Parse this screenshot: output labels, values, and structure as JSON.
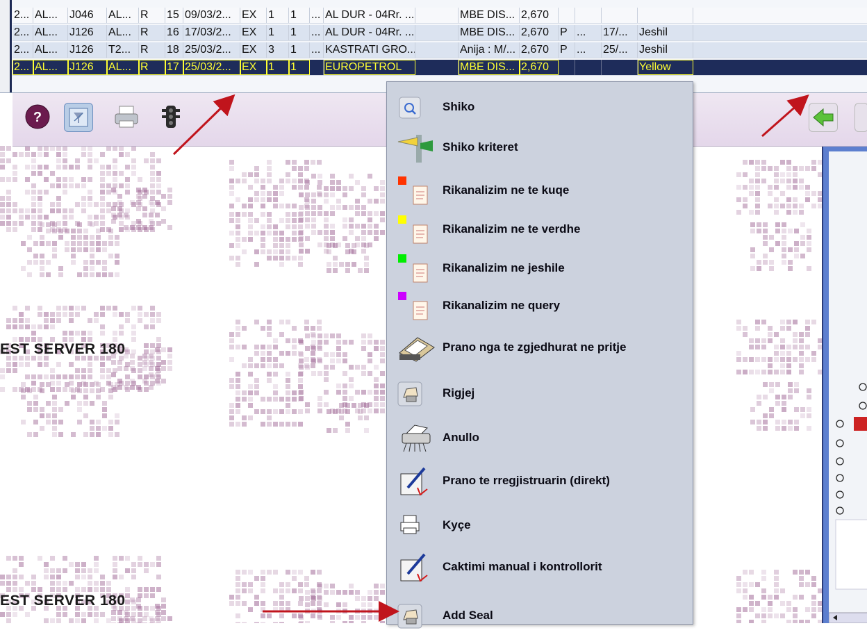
{
  "grid": {
    "rows": [
      {
        "c1": "2...",
        "c2": "AL...",
        "c3": "J046",
        "c4": "AL...",
        "c5": "R",
        "c6": "15",
        "c7": "09/03/2...",
        "c8": "EX",
        "c9": "1",
        "c10": "1",
        "c11": "...",
        "c12": "AL DUR - 04Rr. ...",
        "c13": "",
        "c14": "MBE DIS...",
        "c15": "2,670",
        "c16": "",
        "c17": "",
        "c18": "",
        "c19": ""
      },
      {
        "c1": "2...",
        "c2": "AL...",
        "c3": "J126",
        "c4": "AL...",
        "c5": "R",
        "c6": "16",
        "c7": "17/03/2...",
        "c8": "EX",
        "c9": "1",
        "c10": "1",
        "c11": "...",
        "c12": "AL DUR - 04Rr. ...",
        "c13": "",
        "c14": "MBE DIS...",
        "c15": "2,670",
        "c16": "P",
        "c17": "...",
        "c18": "17/...",
        "c19": "Jeshil"
      },
      {
        "c1": "2...",
        "c2": "AL...",
        "c3": "J126",
        "c4": "T2...",
        "c5": "R",
        "c6": "18",
        "c7": "25/03/2...",
        "c8": "EX",
        "c9": "3",
        "c10": "1",
        "c11": "...",
        "c12": "KASTRATI GRO...",
        "c13": "",
        "c14": "Anija : M/...",
        "c15": "2,670",
        "c16": "P",
        "c17": "...",
        "c18": "25/...",
        "c19": "Jeshil"
      },
      {
        "c1": "2...",
        "c2": "AL...",
        "c3": "J126",
        "c4": "AL...",
        "c5": "R",
        "c6": "17",
        "c7": "25/03/2...",
        "c8": "EX",
        "c9": "1",
        "c10": "1",
        "c11": "",
        "c12": "EUROPETROL",
        "c13": "",
        "c14": "MBE DIS...",
        "c15": "2,670",
        "c16": "",
        "c17": "",
        "c18": "",
        "c19": "Yellow"
      }
    ]
  },
  "background": {
    "watermark": "EST SERVER 180"
  },
  "toolbar": {
    "icons": [
      "help-icon",
      "filter-clear-icon",
      "printer-icon",
      "traffic-light-icon"
    ],
    "right_icons": [
      "back-arrow-icon"
    ]
  },
  "context_menu": {
    "items": [
      {
        "label": "Shiko",
        "icon": "magnifier-icon"
      },
      {
        "label": "Shiko  kriteret",
        "icon": "criteria-signpost-icon"
      },
      {
        "label": "Rikanalizim ne te kuqe",
        "icon": "reanalyze-red-icon",
        "color": "#ff3300"
      },
      {
        "label": "Rikanalizim ne te verdhe",
        "icon": "reanalyze-yellow-icon",
        "color": "#ffff00"
      },
      {
        "label": "Rikanalizim ne jeshile",
        "icon": "reanalyze-green-icon",
        "color": "#00ee00"
      },
      {
        "label": "Rikanalizim ne query",
        "icon": "reanalyze-query-icon",
        "color": "#cc00ff"
      },
      {
        "label": "Prano nga te zgjedhurat ne pritje",
        "icon": "scanner-icon"
      },
      {
        "label": "Rigjej",
        "icon": "stamp-hand-icon"
      },
      {
        "label": "Anullo",
        "icon": "shredder-icon"
      },
      {
        "label": "Prano te rregjistruarin (direkt)",
        "icon": "signing-hand-icon"
      },
      {
        "label": "Kyçe",
        "icon": "lock-printer-icon"
      },
      {
        "label": "Caktimi manual i kontrollorit",
        "icon": "signing-hand-icon"
      },
      {
        "label": "Add Seal",
        "icon": "seal-hand-icon"
      }
    ]
  },
  "colors": {
    "selection_bg": "#1e2c5a",
    "selection_text": "#ffff33",
    "arrow": "#c0141c",
    "menu_bg": "#ccd2de"
  }
}
